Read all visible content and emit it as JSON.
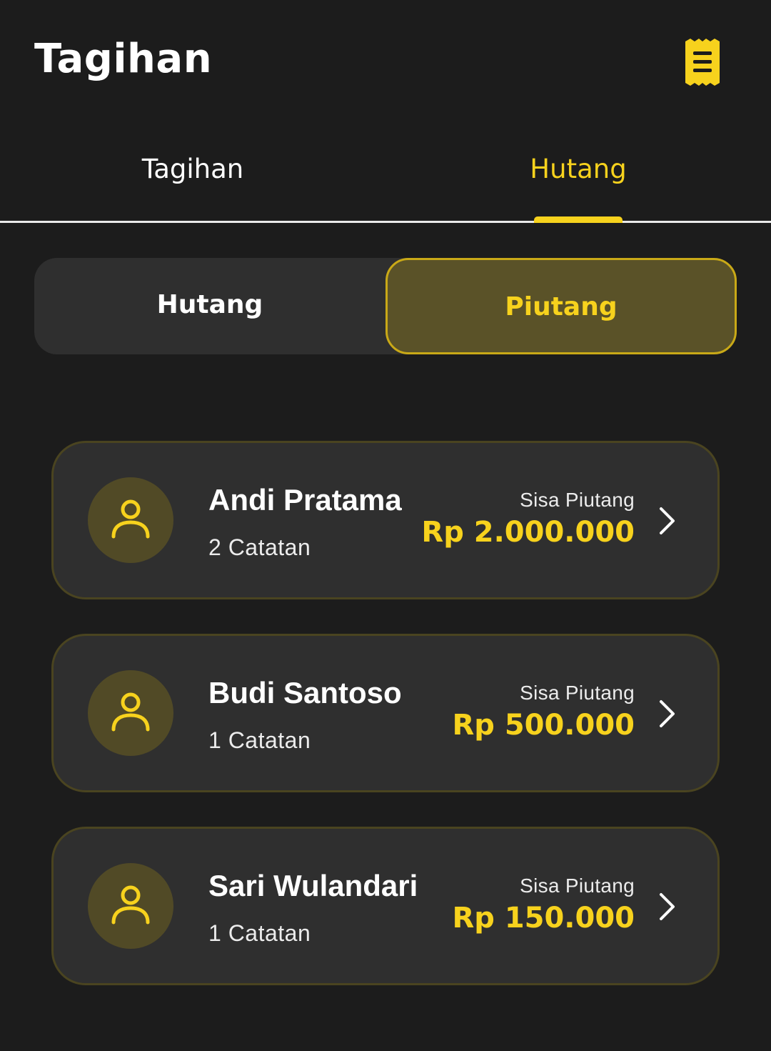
{
  "header": {
    "title": "Tagihan",
    "icon": "receipt-icon"
  },
  "tabs": [
    {
      "label": "Tagihan",
      "active": false
    },
    {
      "label": "Hutang",
      "active": true
    }
  ],
  "segment": {
    "options": [
      "Hutang",
      "Piutang"
    ],
    "selected": "Piutang"
  },
  "people": [
    {
      "name": "Andi Pratama",
      "records": "2 Catatan",
      "balance_label": "Sisa Piutang",
      "amount": "Rp 2.000.000"
    },
    {
      "name": "Budi Santoso",
      "records": "1 Catatan",
      "balance_label": "Sisa Piutang",
      "amount": "Rp 500.000"
    },
    {
      "name": "Sari Wulandari",
      "records": "1 Catatan",
      "balance_label": "Sisa Piutang",
      "amount": "Rp 150.000"
    }
  ],
  "colors": {
    "accent": "#f7d21d",
    "background": "#1c1c1c",
    "card": "#2f2f2f"
  }
}
